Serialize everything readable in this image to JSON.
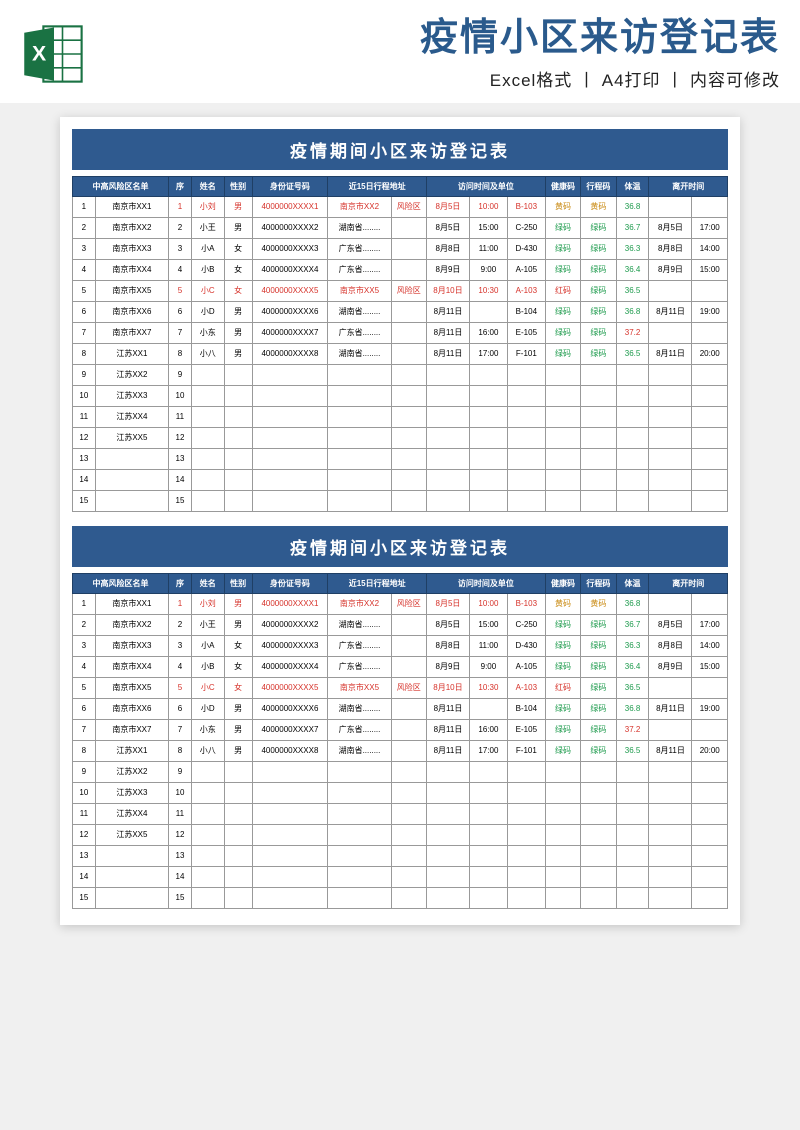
{
  "header": {
    "main_title": "疫情小区来访登记表",
    "subtitle": "Excel格式 丨 A4打印 丨 内容可修改"
  },
  "sheet_title": "疫情期间小区来访登记表",
  "columns": {
    "risk_area": "中高风险区名单",
    "seq": "序",
    "name": "姓名",
    "gender": "性别",
    "id_no": "身份证号码",
    "travel15": "近15日行程地址",
    "risk_flag": "",
    "visit_date": "访问时间及单位",
    "visit_time": "",
    "unit": "",
    "health_code": "健康码",
    "travel_code": "行程码",
    "temp": "体温",
    "leave_date": "离开时间",
    "leave_time": ""
  },
  "risk_list": [
    "南京市XX1",
    "南京市XX2",
    "南京市XX3",
    "南京市XX4",
    "南京市XX5",
    "南京市XX6",
    "南京市XX7",
    "江苏XX1",
    "江苏XX2",
    "江苏XX3",
    "江苏XX4",
    "江苏XX5",
    "",
    "",
    ""
  ],
  "rows": [
    {
      "seq": "1",
      "name": "小刘",
      "gender": "男",
      "id": "4000000XXXX1",
      "travel": "南京市XX2",
      "risk": "风险区",
      "vdate": "8月5日",
      "vtime": "10:00",
      "unit": "B-103",
      "hcode": "黄码",
      "tcode": "黄码",
      "temp": "36.8",
      "ldate": "",
      "ltime": "",
      "red": true,
      "hc_color": "yellow",
      "tc_color": "yellow",
      "temp_red": false
    },
    {
      "seq": "2",
      "name": "小王",
      "gender": "男",
      "id": "4000000XXXX2",
      "travel": "湖南省........",
      "risk": "",
      "vdate": "8月5日",
      "vtime": "15:00",
      "unit": "C-250",
      "hcode": "绿码",
      "tcode": "绿码",
      "temp": "36.7",
      "ldate": "8月5日",
      "ltime": "17:00",
      "red": false,
      "hc_color": "green",
      "tc_color": "green",
      "temp_red": false
    },
    {
      "seq": "3",
      "name": "小A",
      "gender": "女",
      "id": "4000000XXXX3",
      "travel": "广东省........",
      "risk": "",
      "vdate": "8月8日",
      "vtime": "11:00",
      "unit": "D-430",
      "hcode": "绿码",
      "tcode": "绿码",
      "temp": "36.3",
      "ldate": "8月8日",
      "ltime": "14:00",
      "red": false,
      "hc_color": "green",
      "tc_color": "green",
      "temp_red": false
    },
    {
      "seq": "4",
      "name": "小B",
      "gender": "女",
      "id": "4000000XXXX4",
      "travel": "广东省........",
      "risk": "",
      "vdate": "8月9日",
      "vtime": "9:00",
      "unit": "A-105",
      "hcode": "绿码",
      "tcode": "绿码",
      "temp": "36.4",
      "ldate": "8月9日",
      "ltime": "15:00",
      "red": false,
      "hc_color": "green",
      "tc_color": "green",
      "temp_red": false
    },
    {
      "seq": "5",
      "name": "小C",
      "gender": "女",
      "id": "4000000XXXX5",
      "travel": "南京市XX5",
      "risk": "风险区",
      "vdate": "8月10日",
      "vtime": "10:30",
      "unit": "A-103",
      "hcode": "红码",
      "tcode": "绿码",
      "temp": "36.5",
      "ldate": "",
      "ltime": "",
      "red": true,
      "hc_color": "red",
      "tc_color": "green",
      "temp_red": false
    },
    {
      "seq": "6",
      "name": "小D",
      "gender": "男",
      "id": "4000000XXXX6",
      "travel": "湖南省........",
      "risk": "",
      "vdate": "8月11日",
      "vtime": "",
      "unit": "B-104",
      "hcode": "绿码",
      "tcode": "绿码",
      "temp": "36.8",
      "ldate": "8月11日",
      "ltime": "19:00",
      "red": false,
      "hc_color": "green",
      "tc_color": "green",
      "temp_red": false
    },
    {
      "seq": "7",
      "name": "小东",
      "gender": "男",
      "id": "4000000XXXX7",
      "travel": "广东省........",
      "risk": "",
      "vdate": "8月11日",
      "vtime": "16:00",
      "unit": "E-105",
      "hcode": "绿码",
      "tcode": "绿码",
      "temp": "37.2",
      "ldate": "",
      "ltime": "",
      "red": false,
      "hc_color": "green",
      "tc_color": "green",
      "temp_red": true
    },
    {
      "seq": "8",
      "name": "小八",
      "gender": "男",
      "id": "4000000XXXX8",
      "travel": "湖南省........",
      "risk": "",
      "vdate": "8月11日",
      "vtime": "17:00",
      "unit": "F-101",
      "hcode": "绿码",
      "tcode": "绿码",
      "temp": "36.5",
      "ldate": "8月11日",
      "ltime": "20:00",
      "red": false,
      "hc_color": "green",
      "tc_color": "green",
      "temp_red": false
    },
    {
      "seq": "9"
    },
    {
      "seq": "10"
    },
    {
      "seq": "11"
    },
    {
      "seq": "12"
    },
    {
      "seq": "13"
    },
    {
      "seq": "14"
    },
    {
      "seq": "15"
    }
  ]
}
